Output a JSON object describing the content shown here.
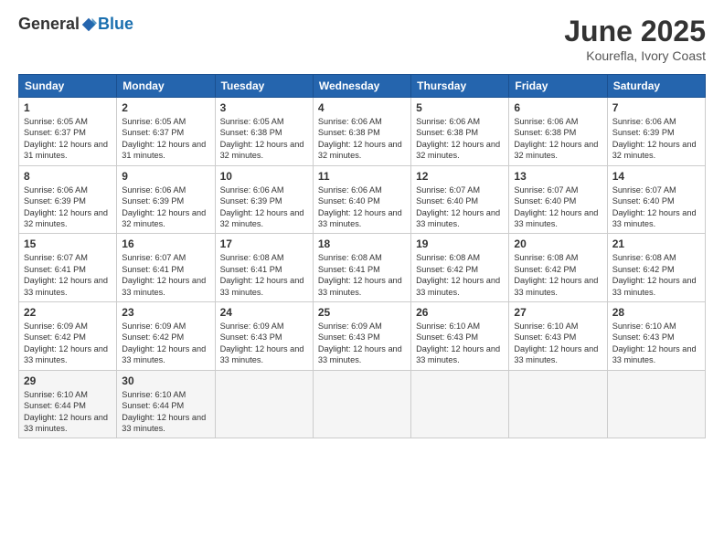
{
  "logo": {
    "general": "General",
    "blue": "Blue"
  },
  "title": "June 2025",
  "subtitle": "Kourefla, Ivory Coast",
  "days": [
    "Sunday",
    "Monday",
    "Tuesday",
    "Wednesday",
    "Thursday",
    "Friday",
    "Saturday"
  ],
  "weeks": [
    [
      {
        "day": "1",
        "sunrise": "6:05 AM",
        "sunset": "6:37 PM",
        "daylight": "12 hours and 31 minutes."
      },
      {
        "day": "2",
        "sunrise": "6:05 AM",
        "sunset": "6:37 PM",
        "daylight": "12 hours and 31 minutes."
      },
      {
        "day": "3",
        "sunrise": "6:05 AM",
        "sunset": "6:38 PM",
        "daylight": "12 hours and 32 minutes."
      },
      {
        "day": "4",
        "sunrise": "6:06 AM",
        "sunset": "6:38 PM",
        "daylight": "12 hours and 32 minutes."
      },
      {
        "day": "5",
        "sunrise": "6:06 AM",
        "sunset": "6:38 PM",
        "daylight": "12 hours and 32 minutes."
      },
      {
        "day": "6",
        "sunrise": "6:06 AM",
        "sunset": "6:38 PM",
        "daylight": "12 hours and 32 minutes."
      },
      {
        "day": "7",
        "sunrise": "6:06 AM",
        "sunset": "6:39 PM",
        "daylight": "12 hours and 32 minutes."
      }
    ],
    [
      {
        "day": "8",
        "sunrise": "6:06 AM",
        "sunset": "6:39 PM",
        "daylight": "12 hours and 32 minutes."
      },
      {
        "day": "9",
        "sunrise": "6:06 AM",
        "sunset": "6:39 PM",
        "daylight": "12 hours and 32 minutes."
      },
      {
        "day": "10",
        "sunrise": "6:06 AM",
        "sunset": "6:39 PM",
        "daylight": "12 hours and 32 minutes."
      },
      {
        "day": "11",
        "sunrise": "6:06 AM",
        "sunset": "6:40 PM",
        "daylight": "12 hours and 33 minutes."
      },
      {
        "day": "12",
        "sunrise": "6:07 AM",
        "sunset": "6:40 PM",
        "daylight": "12 hours and 33 minutes."
      },
      {
        "day": "13",
        "sunrise": "6:07 AM",
        "sunset": "6:40 PM",
        "daylight": "12 hours and 33 minutes."
      },
      {
        "day": "14",
        "sunrise": "6:07 AM",
        "sunset": "6:40 PM",
        "daylight": "12 hours and 33 minutes."
      }
    ],
    [
      {
        "day": "15",
        "sunrise": "6:07 AM",
        "sunset": "6:41 PM",
        "daylight": "12 hours and 33 minutes."
      },
      {
        "day": "16",
        "sunrise": "6:07 AM",
        "sunset": "6:41 PM",
        "daylight": "12 hours and 33 minutes."
      },
      {
        "day": "17",
        "sunrise": "6:08 AM",
        "sunset": "6:41 PM",
        "daylight": "12 hours and 33 minutes."
      },
      {
        "day": "18",
        "sunrise": "6:08 AM",
        "sunset": "6:41 PM",
        "daylight": "12 hours and 33 minutes."
      },
      {
        "day": "19",
        "sunrise": "6:08 AM",
        "sunset": "6:42 PM",
        "daylight": "12 hours and 33 minutes."
      },
      {
        "day": "20",
        "sunrise": "6:08 AM",
        "sunset": "6:42 PM",
        "daylight": "12 hours and 33 minutes."
      },
      {
        "day": "21",
        "sunrise": "6:08 AM",
        "sunset": "6:42 PM",
        "daylight": "12 hours and 33 minutes."
      }
    ],
    [
      {
        "day": "22",
        "sunrise": "6:09 AM",
        "sunset": "6:42 PM",
        "daylight": "12 hours and 33 minutes."
      },
      {
        "day": "23",
        "sunrise": "6:09 AM",
        "sunset": "6:42 PM",
        "daylight": "12 hours and 33 minutes."
      },
      {
        "day": "24",
        "sunrise": "6:09 AM",
        "sunset": "6:43 PM",
        "daylight": "12 hours and 33 minutes."
      },
      {
        "day": "25",
        "sunrise": "6:09 AM",
        "sunset": "6:43 PM",
        "daylight": "12 hours and 33 minutes."
      },
      {
        "day": "26",
        "sunrise": "6:10 AM",
        "sunset": "6:43 PM",
        "daylight": "12 hours and 33 minutes."
      },
      {
        "day": "27",
        "sunrise": "6:10 AM",
        "sunset": "6:43 PM",
        "daylight": "12 hours and 33 minutes."
      },
      {
        "day": "28",
        "sunrise": "6:10 AM",
        "sunset": "6:43 PM",
        "daylight": "12 hours and 33 minutes."
      }
    ],
    [
      {
        "day": "29",
        "sunrise": "6:10 AM",
        "sunset": "6:44 PM",
        "daylight": "12 hours and 33 minutes."
      },
      {
        "day": "30",
        "sunrise": "6:10 AM",
        "sunset": "6:44 PM",
        "daylight": "12 hours and 33 minutes."
      },
      null,
      null,
      null,
      null,
      null
    ]
  ]
}
